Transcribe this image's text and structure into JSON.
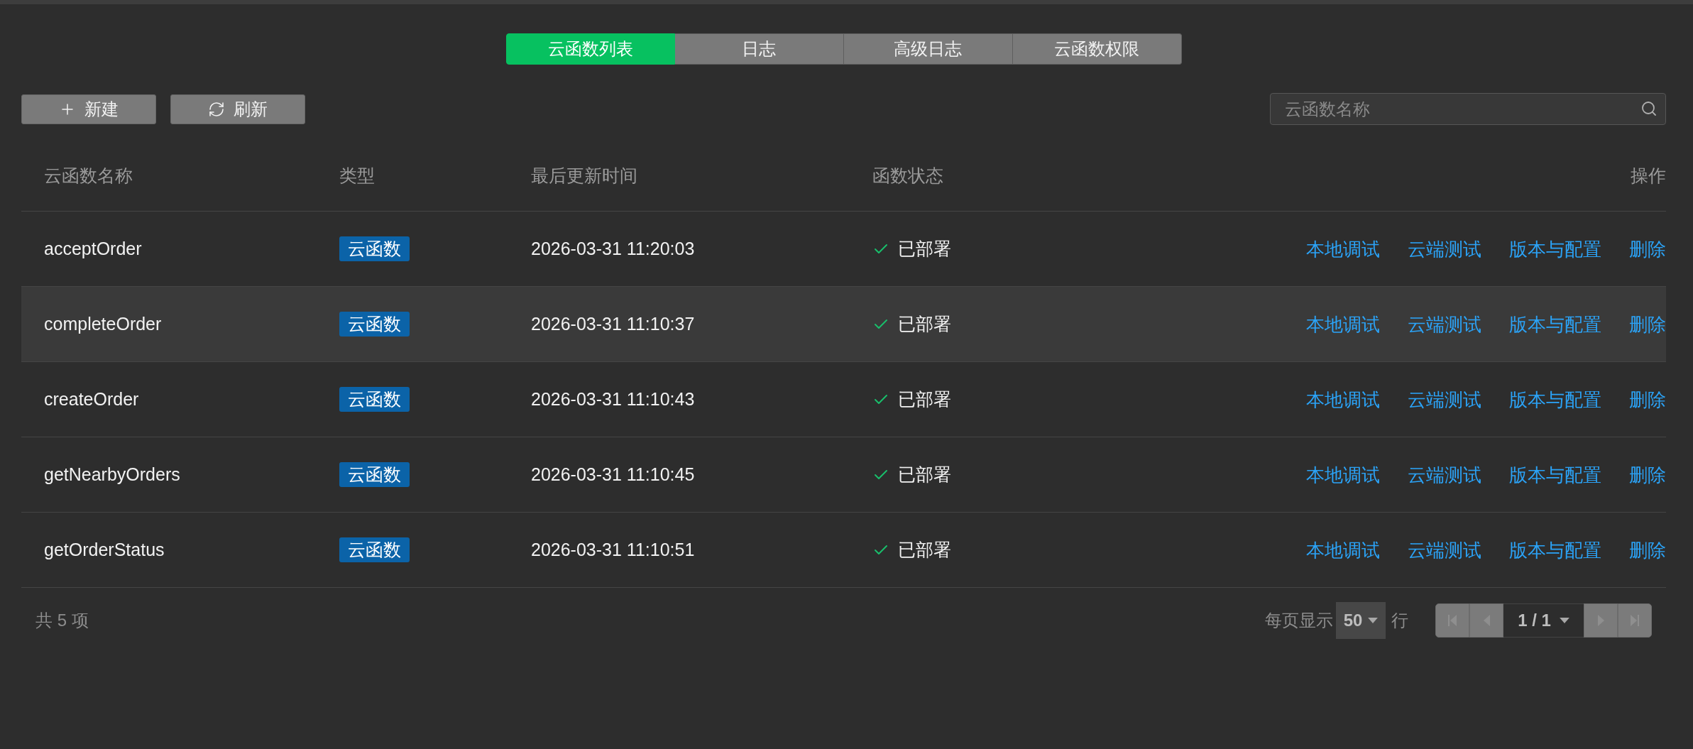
{
  "tabs": [
    {
      "label": "云函数列表",
      "selected": true
    },
    {
      "label": "日志",
      "selected": false
    },
    {
      "label": "高级日志",
      "selected": false
    },
    {
      "label": "云函数权限",
      "selected": false
    }
  ],
  "toolbar": {
    "buttons": [
      {
        "kind": "new",
        "label": "新建"
      },
      {
        "kind": "refresh",
        "label": "刷新"
      }
    ]
  },
  "search": {
    "placeholder": "云函数名称"
  },
  "table": {
    "columns": [
      "云函数名称",
      "类型",
      "最后更新时间",
      "函数状态",
      "操作"
    ],
    "rows": [
      {
        "name": "acceptOrder",
        "type": "云函数",
        "updated": "2026-03-31 11:20:03",
        "status": {
          "kind": "deployed",
          "label": "已部署"
        },
        "hovered": false,
        "actions": [
          "本地调试",
          "云端测试",
          "版本与配置",
          "删除"
        ]
      },
      {
        "name": "completeOrder",
        "type": "云函数",
        "updated": "2026-03-31 11:10:37",
        "status": {
          "kind": "deployed",
          "label": "已部署"
        },
        "hovered": true,
        "actions": [
          "本地调试",
          "云端测试",
          "版本与配置",
          "删除"
        ]
      },
      {
        "name": "createOrder",
        "type": "云函数",
        "updated": "2026-03-31 11:10:43",
        "status": {
          "kind": "deployed",
          "label": "已部署"
        },
        "hovered": false,
        "actions": [
          "本地调试",
          "云端测试",
          "版本与配置",
          "删除"
        ]
      },
      {
        "name": "getNearbyOrders",
        "type": "云函数",
        "updated": "2026-03-31 11:10:45",
        "status": {
          "kind": "deployed",
          "label": "已部署"
        },
        "hovered": false,
        "actions": [
          "本地调试",
          "云端测试",
          "版本与配置",
          "删除"
        ]
      },
      {
        "name": "getOrderStatus",
        "type": "云函数",
        "updated": "2026-03-31 11:10:51",
        "status": {
          "kind": "deployed",
          "label": "已部署"
        },
        "hovered": false,
        "actions": [
          "本地调试",
          "云端测试",
          "版本与配置",
          "删除"
        ]
      }
    ]
  },
  "footer": {
    "total": "共 5 项",
    "page_size_label": "每页显示",
    "page_size": "50",
    "page_size_unit": "行",
    "pager": {
      "items": [
        {
          "kind": "first",
          "disabled": true
        },
        {
          "kind": "prev",
          "disabled": true
        },
        {
          "kind": "page",
          "label": "1 / 1"
        },
        {
          "kind": "next",
          "disabled": true
        },
        {
          "kind": "last",
          "disabled": true
        }
      ]
    }
  }
}
